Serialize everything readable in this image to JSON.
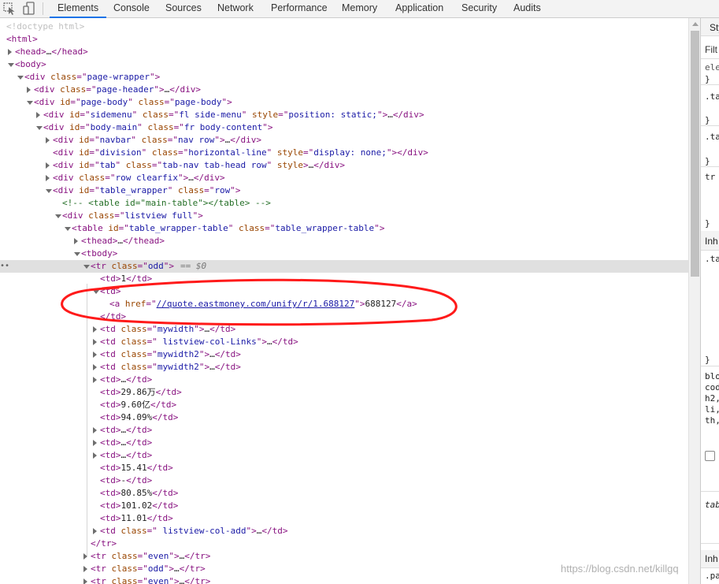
{
  "toolbar": {
    "inspect_icon": "cursor-arrow-icon",
    "device_icon": "device-toggle-icon",
    "tabs": [
      {
        "label": "Elements"
      },
      {
        "label": "Console"
      },
      {
        "label": "Sources"
      },
      {
        "label": "Network"
      },
      {
        "label": "Performance"
      },
      {
        "label": "Memory"
      },
      {
        "label": "Application"
      },
      {
        "label": "Security"
      },
      {
        "label": "Audits"
      }
    ],
    "active_tab": "Elements"
  },
  "styles_pane": {
    "tab_label": "Sty",
    "filter_placeholder": "Filt",
    "lines": {
      "l1": "ele",
      "l2": "}",
      "l3": ".ta",
      "l4": "}",
      "l5": ".ta",
      "l6": "}",
      "l7": "tr",
      "l8": "}",
      "inh1": "Inh",
      "l9": ".ta",
      "l10": "}",
      "b1": "blo",
      "b2": "cod",
      "b3": "h2,",
      "b4": "li,",
      "b5": "th,",
      "tab": "tab",
      "inh2": "Inh",
      "pa": ".pa"
    }
  },
  "tree": {
    "selected_suffix": "== $0",
    "lines": [
      {
        "t": "<!doctype html>"
      },
      {
        "t": "<html>"
      },
      {
        "t": "<head>…</head>"
      },
      {
        "t": "<body>"
      },
      {
        "t": "<div class=\"page-wrapper\">"
      },
      {
        "t": "<div class=\"page-header\">…</div>"
      },
      {
        "t": "<div id=\"page-body\" class=\"page-body\">"
      },
      {
        "t": "<div id=\"sidemenu\" class=\"fl side-menu\" style=\"position: static;\">…</div>"
      },
      {
        "t": "<div id=\"body-main\" class=\"fr body-content\">"
      },
      {
        "t": "<div id=\"navbar\" class=\"nav row\">…</div>"
      },
      {
        "t": "<div id=\"division\" class=\"horizontal-line\" style=\"display: none;\"></div>"
      },
      {
        "t": "<div id=\"tab\" class=\"tab-nav tab-head row\" style>…</div>"
      },
      {
        "t": "<div class=\"row clearfix\">…</div>"
      },
      {
        "t": "<div id=\"table_wrapper\" class=\"row\">"
      },
      {
        "t": "<!-- <table id=\"main-table\"></table> -->"
      },
      {
        "t": "<div class=\"listview full\">"
      },
      {
        "t": "<table id=\"table_wrapper-table\" class=\"table_wrapper-table\">"
      },
      {
        "t": "<thead>…</thead>"
      },
      {
        "t": "<tbody>"
      },
      {
        "t": "<tr class=\"odd\">"
      },
      {
        "t": "<td>1</td>"
      },
      {
        "t": "<td>"
      },
      {
        "t": "<a href=\"//quote.eastmoney.com/unify/r/1.688127\">688127</a>"
      },
      {
        "t": "</td>"
      },
      {
        "t": "<td class=\"mywidth\">…</td>"
      },
      {
        "t": "<td class=\" listview-col-Links\">…</td>"
      },
      {
        "t": "<td class=\"mywidth2\">…</td>"
      },
      {
        "t": "<td class=\"mywidth2\">…</td>"
      },
      {
        "t": "<td>…</td>"
      },
      {
        "t": "<td>29.86万</td>"
      },
      {
        "t": "<td>9.60亿</td>"
      },
      {
        "t": "<td>94.09%</td>"
      },
      {
        "t": "<td>…</td>"
      },
      {
        "t": "<td>…</td>"
      },
      {
        "t": "<td>…</td>"
      },
      {
        "t": "<td>15.41</td>"
      },
      {
        "t": "<td>-</td>"
      },
      {
        "t": "<td>80.85%</td>"
      },
      {
        "t": "<td>101.02</td>"
      },
      {
        "t": "<td>11.01</td>"
      },
      {
        "t": "<td class=\" listview-col-add\">…</td>"
      },
      {
        "t": "</tr>"
      },
      {
        "t": "<tr class=\"even\">…</tr>"
      },
      {
        "t": "<tr class=\"odd\">…</tr>"
      },
      {
        "t": "<tr class=\"even\">…</tr>"
      }
    ]
  },
  "watermark": "https://blog.csdn.net/killgq",
  "colors": {
    "tag": "#881280",
    "attr_name": "#994500",
    "attr_value": "#1a1aa6",
    "comment": "#236e25",
    "annotation": "#ff1a1a",
    "active_tab_underline": "#1a73e8"
  }
}
